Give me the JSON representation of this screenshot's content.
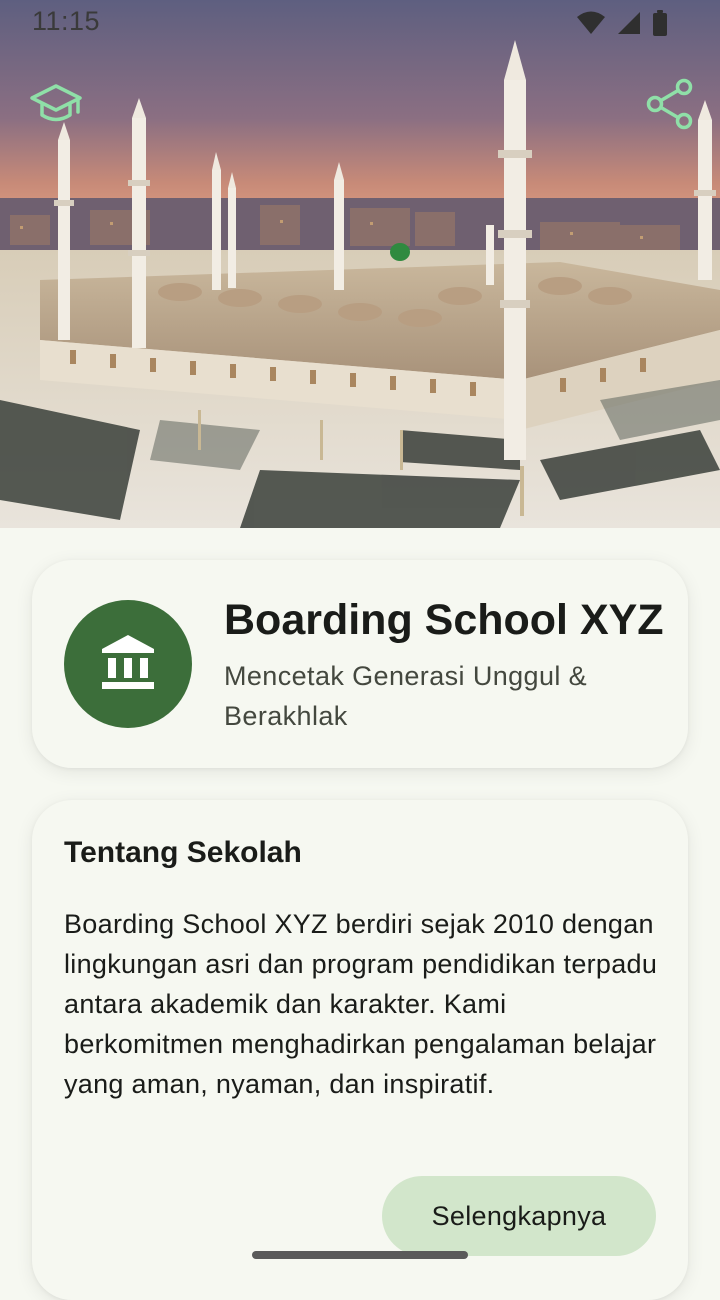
{
  "status_bar": {
    "time": "11:15"
  },
  "hero": {
    "left_icon": "graduation-cap-icon",
    "right_icon": "share-icon",
    "accent_color": "#8fe0a8"
  },
  "school": {
    "name": "Boarding School XYZ",
    "tagline": "Mencetak Generasi Unggul & Berakhlak",
    "logo_icon": "institution-icon",
    "logo_color": "#3c6e3a"
  },
  "about": {
    "title": "Tentang Sekolah",
    "body": "Boarding School XYZ berdiri sejak 2010 dengan lingkungan asri dan program pendidikan terpadu antara akademik dan karakter. Kami berkomitmen menghadirkan pengalaman belajar yang aman, nyaman, dan inspiratif.",
    "button_label": "Selengkapnya",
    "button_color": "#d2e6cb"
  }
}
